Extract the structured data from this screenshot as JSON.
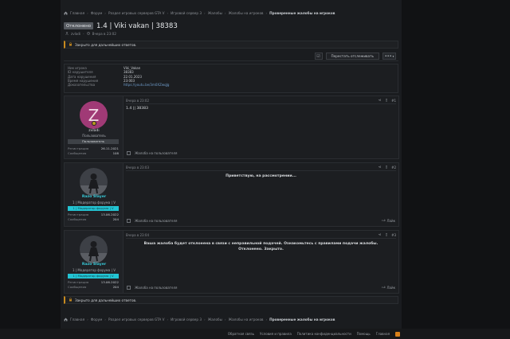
{
  "breadcrumb": [
    "Главная",
    "Форум",
    "Раздел игровых серверов GTA V",
    "Игровой сервер 3",
    "Жалобы",
    "Жалобы на игроков",
    "Проверенные жалобы на игроков"
  ],
  "thread": {
    "status_badge": "Отклонено",
    "title": "1.4 | Viki vakan | 38383",
    "author": "zvladi",
    "date": "Вчера в 23:02"
  },
  "notice_text": "Закрыто для дальнейших ответов.",
  "toolbar": {
    "watch_label": "Перестать отслеживать",
    "more_label": "•••"
  },
  "fields": [
    {
      "k": "Ник игрока",
      "v": "Viki_Vakan",
      "link": false
    },
    {
      "k": "ID нарушителя",
      "v": "38383",
      "link": false
    },
    {
      "k": "Дата нарушения",
      "v": "22.01.2023",
      "link": false
    },
    {
      "k": "Время нарушения",
      "v": "23:003",
      "link": false
    },
    {
      "k": "Доказательства",
      "v": "https://youtu.be/3m0XZwqJg",
      "link": true
    }
  ],
  "posts": [
    {
      "avatar_letter": "Z",
      "user": "zvladi",
      "user_title": "Пользователь",
      "user_badge": "Пользователь",
      "reg_label": "Регистрация",
      "reg": "26.11.2021",
      "msg_label": "Сообщения",
      "msgs": "108",
      "date": "Вчера в 23:02",
      "num": "#1",
      "content": "1.4 || 38383",
      "complain": "Жалоба на пользователя",
      "like": ""
    },
    {
      "user": "Razo Slayer",
      "user_title": "1 | Модератор форума | V",
      "user_badge": "1 | Модератор форума | V",
      "reg_label": "Регистрация",
      "reg": "13.06.2022",
      "msg_label": "Сообщения",
      "msgs": "204",
      "date": "Вчера в 23:03",
      "num": "#2",
      "content": "Приветствую, на рассмотрении...",
      "complain": "Жалоба на пользователя",
      "like": "Лайк"
    },
    {
      "user": "Razo Slayer",
      "user_title": "1 | Модератор форума | V",
      "user_badge": "1 | Модератор форума | V",
      "reg_label": "Регистрация",
      "reg": "13.06.2022",
      "msg_label": "Сообщения",
      "msgs": "204",
      "date": "Вчера в 23:04",
      "num": "#3",
      "content_lines": [
        "Ваша жалоба будет отклонена в связи с неправильной подачей. Ознакомьтесь с правилами подачи жалобы.",
        "Отклонено. Закрыто."
      ],
      "complain": "Жалоба на пользователя",
      "like": "Лайк"
    }
  ],
  "footer": [
    "Обратная связь",
    "Условия и правила",
    "Политика конфиденциальности",
    "Помощь",
    "Главная"
  ],
  "colors": {
    "accent_cyan": "#23c4d3",
    "avatar_pink": "#a03a76",
    "notice_orange": "#c88a1e"
  }
}
